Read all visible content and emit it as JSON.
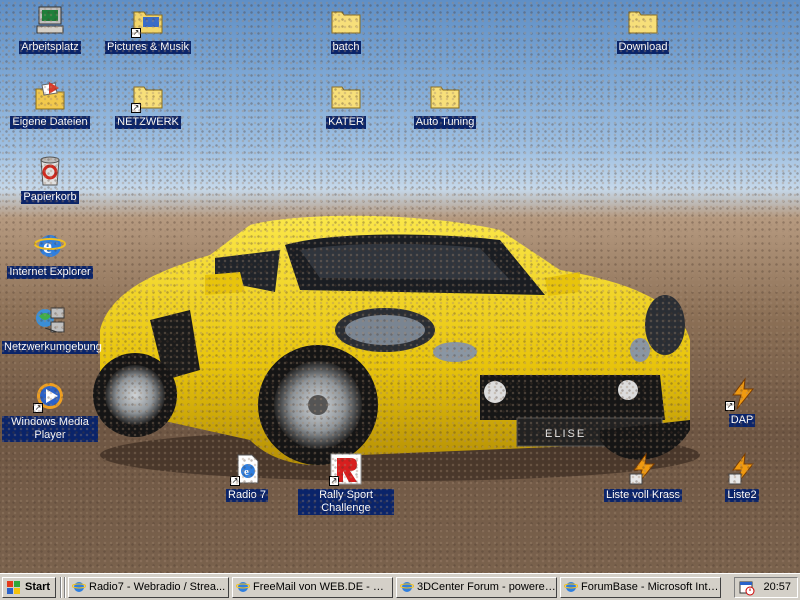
{
  "desktop": {
    "icons": [
      {
        "label": "Arbeitsplatz",
        "icon": "my-computer-icon"
      },
      {
        "label": "Pictures & Musik",
        "icon": "folder-shortcut-icon"
      },
      {
        "label": "batch",
        "icon": "folder-icon"
      },
      {
        "label": "Download",
        "icon": "folder-icon"
      },
      {
        "label": "Eigene Dateien",
        "icon": "my-documents-icon"
      },
      {
        "label": "NETZWERK",
        "icon": "folder-shortcut-icon"
      },
      {
        "label": "KATER",
        "icon": "folder-icon"
      },
      {
        "label": "Auto Tuning",
        "icon": "folder-icon"
      },
      {
        "label": "Papierkorb",
        "icon": "recycle-bin-icon"
      },
      {
        "label": "Internet Explorer",
        "icon": "internet-explorer-icon"
      },
      {
        "label": "Netzwerkumgebung",
        "icon": "network-neighborhood-icon"
      },
      {
        "label": "Windows Media Player",
        "icon": "media-player-icon"
      },
      {
        "label": "Radio 7",
        "icon": "ie-document-shortcut-icon"
      },
      {
        "label": "Rally Sport Challenge",
        "icon": "rally-sport-icon"
      },
      {
        "label": "Liste voll Krass",
        "icon": "winamp-playlist-icon"
      },
      {
        "label": "DAP",
        "icon": "winamp-shortcut-icon"
      },
      {
        "label": "Liste2",
        "icon": "winamp-playlist-icon"
      }
    ],
    "wallpaper_plate": "ELISE"
  },
  "taskbar": {
    "start_label": "Start",
    "tasks": [
      {
        "label": "Radio7 - Webradio / Strea..."
      },
      {
        "label": "FreeMail von WEB.DE - Mi..."
      },
      {
        "label": "3DCenter Forum - powered..."
      },
      {
        "label": "ForumBase - Microsoft Inte..."
      }
    ],
    "clock": "20:57"
  },
  "colors": {
    "selection": "#0a246a",
    "taskbar": "#d4d0c8",
    "car": "#f2d21a"
  }
}
